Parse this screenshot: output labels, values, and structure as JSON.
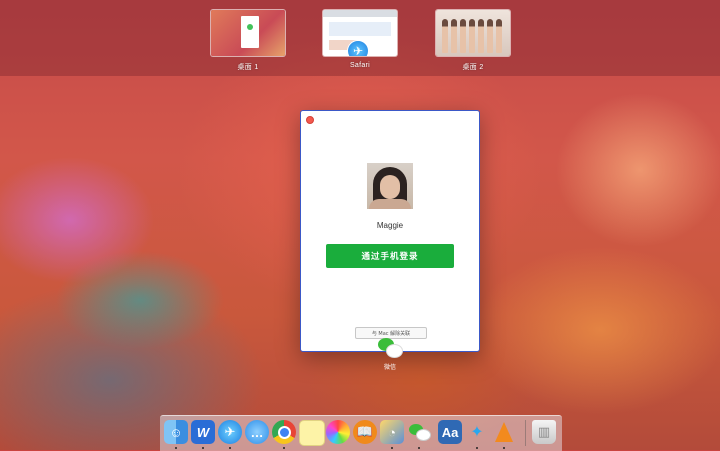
{
  "spaces": [
    {
      "label": "桌面 1",
      "icon": "desktop-thumbnail"
    },
    {
      "label": "Safari",
      "icon": "safari-icon"
    },
    {
      "label": "桌面 2",
      "icon": "desktop-thumbnail"
    }
  ],
  "login_window": {
    "username": "Maggie",
    "login_button": "通过手机登录",
    "unlink_button": "与 Mac 解除关联"
  },
  "app_label": "微信",
  "dock": {
    "items": [
      {
        "name": "finder",
        "icon": "finder-icon"
      },
      {
        "name": "word",
        "icon": "w-icon"
      },
      {
        "name": "safari",
        "icon": "safari-icon"
      },
      {
        "name": "messages",
        "icon": "messages-icon"
      },
      {
        "name": "chrome",
        "icon": "chrome-icon"
      },
      {
        "name": "notes",
        "icon": "notes-icon"
      },
      {
        "name": "photos",
        "icon": "photos-icon"
      },
      {
        "name": "ibooks",
        "icon": "book-icon"
      },
      {
        "name": "preview",
        "icon": "preview-icon"
      },
      {
        "name": "wechat",
        "icon": "wechat-icon"
      },
      {
        "name": "dictionary",
        "icon": "dictionary-icon"
      },
      {
        "name": "xcode",
        "icon": "bird-icon"
      },
      {
        "name": "vlc",
        "icon": "cone-icon"
      },
      {
        "name": "trash",
        "icon": "trash-icon"
      }
    ]
  },
  "colors": {
    "login_green": "#1aad3c",
    "window_border": "#3b58c7",
    "close_red": "#f3594e"
  }
}
